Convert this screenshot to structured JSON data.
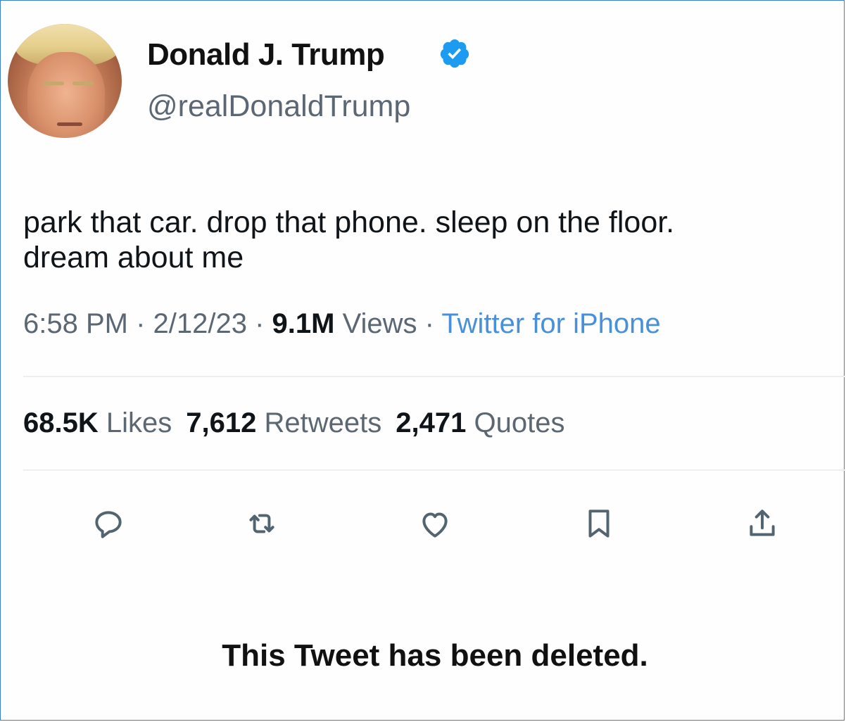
{
  "user": {
    "name": "Donald J. Trump",
    "handle": "@realDonaldTrump",
    "verified_icon": "verified-badge-icon",
    "verified_color": "#1d9bf0"
  },
  "tweet": {
    "line1": "park that car. drop that phone. sleep on the floor.",
    "line2": "dream about me"
  },
  "meta": {
    "time": "6:58 PM",
    "sep1": " · ",
    "date": "2/12/23",
    "sep2": " · ",
    "views_count": "9.1M",
    "views_label": " Views",
    "sep3": " · ",
    "source": "Twitter for iPhone"
  },
  "stats": {
    "likes_count": "68.5K",
    "likes_label": "Likes",
    "retweets_count": "7,612",
    "retweets_label": "Retweets",
    "quotes_count": "2,471",
    "quotes_label": "Quotes"
  },
  "actions": [
    {
      "icon": "reply-icon"
    },
    {
      "icon": "retweet-icon"
    },
    {
      "icon": "like-icon"
    },
    {
      "icon": "bookmark-icon"
    },
    {
      "icon": "share-icon"
    }
  ],
  "status": {
    "deleted_text": "This Tweet has been deleted."
  },
  "colors": {
    "text": "#0f1419",
    "secondary": "#5b6773",
    "link": "#4a90d9",
    "border": "#3b7fd4"
  }
}
